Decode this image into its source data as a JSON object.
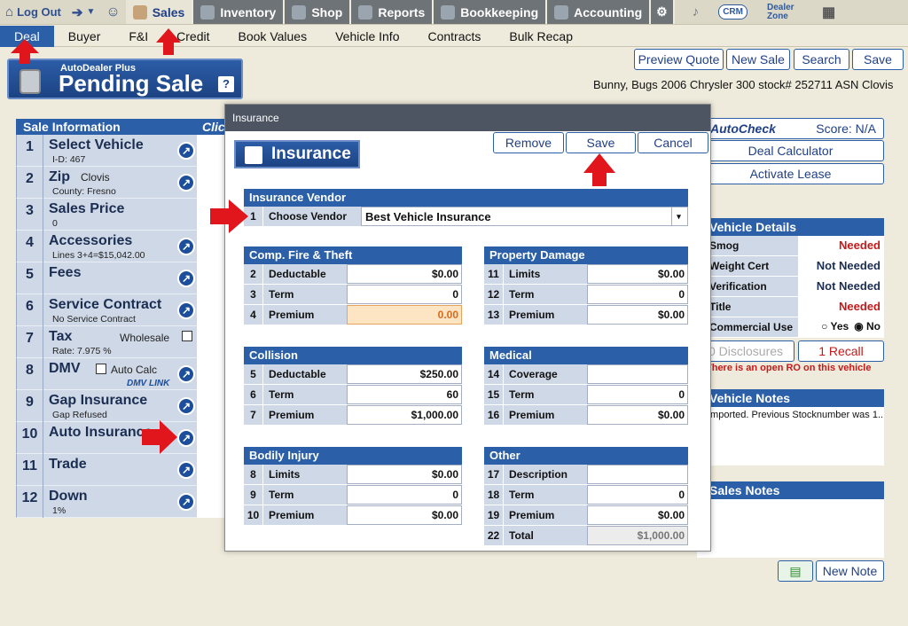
{
  "topnav": {
    "logout": "Log Out",
    "tabs": [
      {
        "label": "Sales",
        "icon": "salesperson-icon",
        "color": "#e8e4d6"
      },
      {
        "label": "Inventory",
        "icon": "car-icon",
        "color": "#6e7377"
      },
      {
        "label": "Shop",
        "icon": "wrench-icon",
        "color": "#6e7377"
      },
      {
        "label": "Reports",
        "icon": "report-icon",
        "color": "#6e7377"
      },
      {
        "label": "Bookkeeping",
        "icon": "book-icon",
        "color": "#6e7377"
      },
      {
        "label": "Accounting",
        "icon": "pie-chart-icon",
        "color": "#6e7377"
      }
    ],
    "crm": "CRM",
    "dealer_zone": "Dealer Zone"
  },
  "subnav": [
    "Deal",
    "Buyer",
    "F&I",
    "Credit",
    "Book Values",
    "Vehicle Info",
    "Contracts",
    "Bulk Recap"
  ],
  "banner": {
    "subtitle": "AutoDealer Plus",
    "title": "Pending Sale",
    "help": "?"
  },
  "actions": [
    "Preview Quote",
    "New Sale",
    "Search",
    "Save"
  ],
  "customer_line": "Bunny, Bugs   2006 Chrysler 300   stock# 252711 ASN Clovis",
  "sale_info": {
    "header": "Sale Information",
    "col2_header": "Click",
    "rows": [
      {
        "num": "1",
        "label": "Select Vehicle",
        "sub": "I-D:  467",
        "go": true
      },
      {
        "num": "2",
        "label": "Zip",
        "sub": "County: Fresno",
        "extra": "Clovis",
        "go": true
      },
      {
        "num": "3",
        "label": "Sales Price",
        "sub": "0",
        "go": false
      },
      {
        "num": "4",
        "label": "Accessories",
        "sub": "Lines 3+4=$15,042.00",
        "go": true
      },
      {
        "num": "5",
        "label": "Fees",
        "sub": "",
        "go": true
      },
      {
        "num": "6",
        "label": "Service Contract",
        "sub": "No Service Contract",
        "go": true
      },
      {
        "num": "7",
        "label": "Tax",
        "sub": "Rate: 7.975 %",
        "extra": "Wholesale",
        "go": false
      },
      {
        "num": "8",
        "label": "DMV",
        "sub": "",
        "extra": "Auto Calc",
        "go": true
      },
      {
        "num": "9",
        "label": "Gap Insurance",
        "sub": "Gap Refused",
        "go": true
      },
      {
        "num": "10",
        "label": "Auto Insurance",
        "sub": "",
        "go": true
      },
      {
        "num": "11",
        "label": "Trade",
        "sub": "",
        "go": true
      },
      {
        "num": "12",
        "label": "Down",
        "sub": "1%",
        "go": true
      }
    ]
  },
  "right": {
    "autocheck": "AutoCheck",
    "score": "Score:  N/A",
    "deal_calculator": "Deal Calculator",
    "activate_lease": "Activate Lease",
    "vehicle_details_header": "Vehicle Details",
    "details": [
      {
        "k": "Smog",
        "v": "Needed",
        "color": "#c41a1a"
      },
      {
        "k": "Weight Cert",
        "v": "Not Needed",
        "color": "#1b2e52"
      },
      {
        "k": "Verification",
        "v": "Not Needed",
        "color": "#1b2e52"
      },
      {
        "k": "Title",
        "v": "Needed",
        "color": "#c41a1a"
      }
    ],
    "commercial_use": "Commercial Use",
    "yes": "Yes",
    "no": "No",
    "disclosures": "0 Disclosures",
    "recall": "1 Recall",
    "open_ro": "There is an open RO on this vehicle",
    "vehicle_notes_header": "Vehicle Notes",
    "vehicle_notes_text": "Imported.  Previous Stocknumber was 1...",
    "sales_notes_header": "Sales Notes",
    "new_note": "New Note"
  },
  "modal": {
    "title": "Insurance",
    "banner": "Insurance",
    "remove": "Remove",
    "save": "Save",
    "cancel": "Cancel",
    "vendor": {
      "header": "Insurance Vendor",
      "num": "1",
      "label": "Choose Vendor",
      "value": "Best Vehicle Insurance"
    },
    "comp": {
      "header": "Comp. Fire & Theft",
      "rows": [
        {
          "n": "2",
          "k": "Deductable",
          "v": "$0.00"
        },
        {
          "n": "3",
          "k": "Term",
          "v": "0"
        },
        {
          "n": "4",
          "k": "Premium",
          "v": "0.00"
        }
      ]
    },
    "property": {
      "header": "Property Damage",
      "rows": [
        {
          "n": "11",
          "k": "Limits",
          "v": "$0.00"
        },
        {
          "n": "12",
          "k": "Term",
          "v": "0"
        },
        {
          "n": "13",
          "k": "Premium",
          "v": "$0.00"
        }
      ]
    },
    "collision": {
      "header": "Collision",
      "rows": [
        {
          "n": "5",
          "k": "Deductable",
          "v": "$250.00"
        },
        {
          "n": "6",
          "k": "Term",
          "v": "60"
        },
        {
          "n": "7",
          "k": "Premium",
          "v": "$1,000.00"
        }
      ]
    },
    "medical": {
      "header": "Medical",
      "rows": [
        {
          "n": "14",
          "k": "Coverage",
          "v": ""
        },
        {
          "n": "15",
          "k": "Term",
          "v": "0"
        },
        {
          "n": "16",
          "k": "Premium",
          "v": "$0.00"
        }
      ]
    },
    "bodily": {
      "header": "Bodily Injury",
      "rows": [
        {
          "n": "8",
          "k": "Limits",
          "v": "$0.00"
        },
        {
          "n": "9",
          "k": "Term",
          "v": "0"
        },
        {
          "n": "10",
          "k": "Premium",
          "v": "$0.00"
        }
      ]
    },
    "other": {
      "header": "Other",
      "rows": [
        {
          "n": "17",
          "k": "Description",
          "v": ""
        },
        {
          "n": "18",
          "k": "Term",
          "v": "0"
        },
        {
          "n": "19",
          "k": "Premium",
          "v": "$0.00"
        },
        {
          "n": "22",
          "k": "Total",
          "v": "$1,000.00"
        }
      ]
    }
  }
}
